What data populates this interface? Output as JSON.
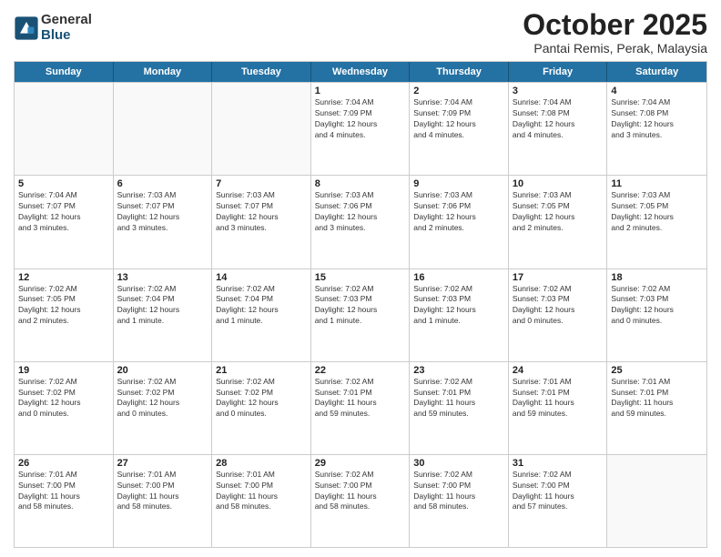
{
  "logo": {
    "general": "General",
    "blue": "Blue"
  },
  "title": "October 2025",
  "subtitle": "Pantai Remis, Perak, Malaysia",
  "days": [
    "Sunday",
    "Monday",
    "Tuesday",
    "Wednesday",
    "Thursday",
    "Friday",
    "Saturday"
  ],
  "weeks": [
    [
      {
        "num": "",
        "text": ""
      },
      {
        "num": "",
        "text": ""
      },
      {
        "num": "",
        "text": ""
      },
      {
        "num": "1",
        "text": "Sunrise: 7:04 AM\nSunset: 7:09 PM\nDaylight: 12 hours\nand 4 minutes."
      },
      {
        "num": "2",
        "text": "Sunrise: 7:04 AM\nSunset: 7:09 PM\nDaylight: 12 hours\nand 4 minutes."
      },
      {
        "num": "3",
        "text": "Sunrise: 7:04 AM\nSunset: 7:08 PM\nDaylight: 12 hours\nand 4 minutes."
      },
      {
        "num": "4",
        "text": "Sunrise: 7:04 AM\nSunset: 7:08 PM\nDaylight: 12 hours\nand 3 minutes."
      }
    ],
    [
      {
        "num": "5",
        "text": "Sunrise: 7:04 AM\nSunset: 7:07 PM\nDaylight: 12 hours\nand 3 minutes."
      },
      {
        "num": "6",
        "text": "Sunrise: 7:03 AM\nSunset: 7:07 PM\nDaylight: 12 hours\nand 3 minutes."
      },
      {
        "num": "7",
        "text": "Sunrise: 7:03 AM\nSunset: 7:07 PM\nDaylight: 12 hours\nand 3 minutes."
      },
      {
        "num": "8",
        "text": "Sunrise: 7:03 AM\nSunset: 7:06 PM\nDaylight: 12 hours\nand 3 minutes."
      },
      {
        "num": "9",
        "text": "Sunrise: 7:03 AM\nSunset: 7:06 PM\nDaylight: 12 hours\nand 2 minutes."
      },
      {
        "num": "10",
        "text": "Sunrise: 7:03 AM\nSunset: 7:05 PM\nDaylight: 12 hours\nand 2 minutes."
      },
      {
        "num": "11",
        "text": "Sunrise: 7:03 AM\nSunset: 7:05 PM\nDaylight: 12 hours\nand 2 minutes."
      }
    ],
    [
      {
        "num": "12",
        "text": "Sunrise: 7:02 AM\nSunset: 7:05 PM\nDaylight: 12 hours\nand 2 minutes."
      },
      {
        "num": "13",
        "text": "Sunrise: 7:02 AM\nSunset: 7:04 PM\nDaylight: 12 hours\nand 1 minute."
      },
      {
        "num": "14",
        "text": "Sunrise: 7:02 AM\nSunset: 7:04 PM\nDaylight: 12 hours\nand 1 minute."
      },
      {
        "num": "15",
        "text": "Sunrise: 7:02 AM\nSunset: 7:03 PM\nDaylight: 12 hours\nand 1 minute."
      },
      {
        "num": "16",
        "text": "Sunrise: 7:02 AM\nSunset: 7:03 PM\nDaylight: 12 hours\nand 1 minute."
      },
      {
        "num": "17",
        "text": "Sunrise: 7:02 AM\nSunset: 7:03 PM\nDaylight: 12 hours\nand 0 minutes."
      },
      {
        "num": "18",
        "text": "Sunrise: 7:02 AM\nSunset: 7:03 PM\nDaylight: 12 hours\nand 0 minutes."
      }
    ],
    [
      {
        "num": "19",
        "text": "Sunrise: 7:02 AM\nSunset: 7:02 PM\nDaylight: 12 hours\nand 0 minutes."
      },
      {
        "num": "20",
        "text": "Sunrise: 7:02 AM\nSunset: 7:02 PM\nDaylight: 12 hours\nand 0 minutes."
      },
      {
        "num": "21",
        "text": "Sunrise: 7:02 AM\nSunset: 7:02 PM\nDaylight: 12 hours\nand 0 minutes."
      },
      {
        "num": "22",
        "text": "Sunrise: 7:02 AM\nSunset: 7:01 PM\nDaylight: 11 hours\nand 59 minutes."
      },
      {
        "num": "23",
        "text": "Sunrise: 7:02 AM\nSunset: 7:01 PM\nDaylight: 11 hours\nand 59 minutes."
      },
      {
        "num": "24",
        "text": "Sunrise: 7:01 AM\nSunset: 7:01 PM\nDaylight: 11 hours\nand 59 minutes."
      },
      {
        "num": "25",
        "text": "Sunrise: 7:01 AM\nSunset: 7:01 PM\nDaylight: 11 hours\nand 59 minutes."
      }
    ],
    [
      {
        "num": "26",
        "text": "Sunrise: 7:01 AM\nSunset: 7:00 PM\nDaylight: 11 hours\nand 58 minutes."
      },
      {
        "num": "27",
        "text": "Sunrise: 7:01 AM\nSunset: 7:00 PM\nDaylight: 11 hours\nand 58 minutes."
      },
      {
        "num": "28",
        "text": "Sunrise: 7:01 AM\nSunset: 7:00 PM\nDaylight: 11 hours\nand 58 minutes."
      },
      {
        "num": "29",
        "text": "Sunrise: 7:02 AM\nSunset: 7:00 PM\nDaylight: 11 hours\nand 58 minutes."
      },
      {
        "num": "30",
        "text": "Sunrise: 7:02 AM\nSunset: 7:00 PM\nDaylight: 11 hours\nand 58 minutes."
      },
      {
        "num": "31",
        "text": "Sunrise: 7:02 AM\nSunset: 7:00 PM\nDaylight: 11 hours\nand 57 minutes."
      },
      {
        "num": "",
        "text": ""
      }
    ]
  ]
}
